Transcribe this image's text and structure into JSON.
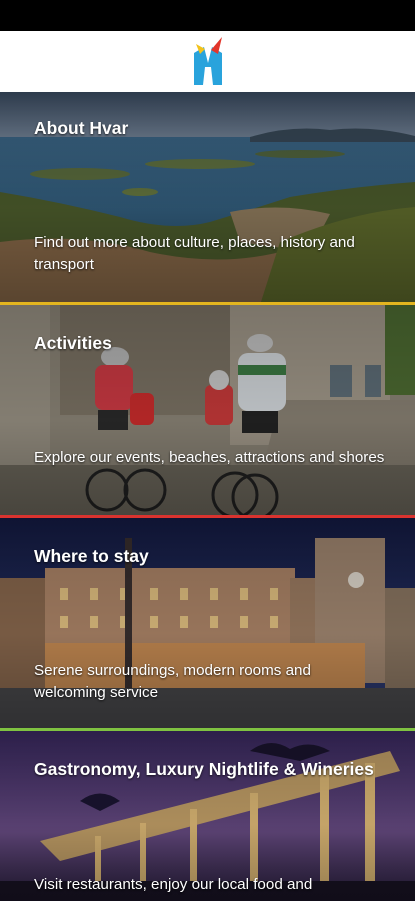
{
  "header": {
    "logo_icon": "hvar-logo-icon"
  },
  "cards": [
    {
      "title": "About Hvar",
      "description": "Find out more about culture, places, history and transport",
      "accent": "#e3b51f"
    },
    {
      "title": "Activities",
      "description": "Explore our events, beaches, attractions and shores",
      "accent": "#d9332f"
    },
    {
      "title": "Where to stay",
      "description": "Serene surroundings, modern rooms and welcoming service",
      "accent": "#7fc241"
    },
    {
      "title": "Gastronomy, Luxury Nightlife & Wineries",
      "description": "Visit restaurants, enjoy our local food and"
    }
  ]
}
